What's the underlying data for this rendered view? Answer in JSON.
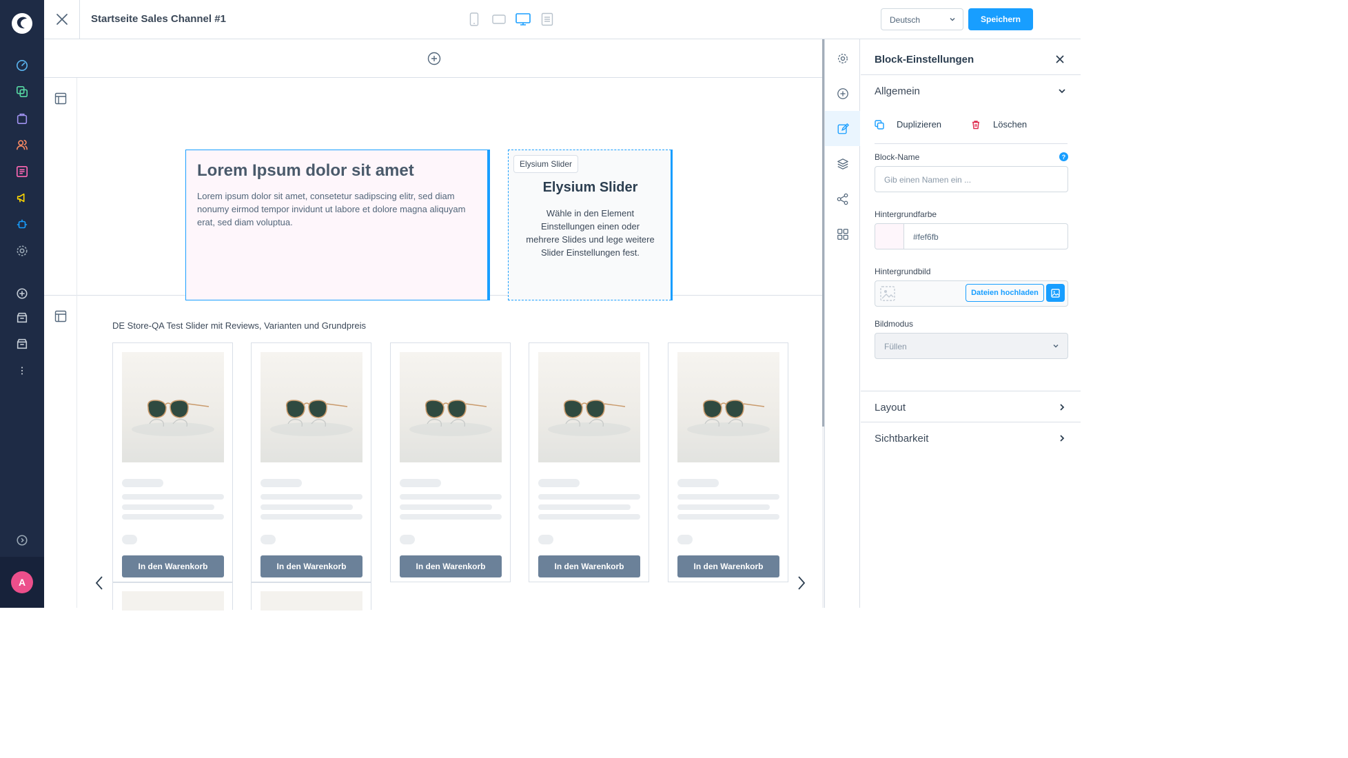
{
  "nav": {
    "avatar_initial": "A",
    "items": [
      {
        "icon": "dashboard-icon",
        "color": "#5ab4f0"
      },
      {
        "icon": "catalogues-icon",
        "color": "#57d9a3"
      },
      {
        "icon": "orders-icon",
        "color": "#a092f0"
      },
      {
        "icon": "customers-icon",
        "color": "#f88962"
      },
      {
        "icon": "content-icon",
        "color": "#ff68b4"
      },
      {
        "icon": "marketing-icon",
        "color": "#ffd700"
      },
      {
        "icon": "extensions-icon",
        "color": "#189eff"
      },
      {
        "icon": "settings-icon",
        "color": "#9aa8b5"
      }
    ]
  },
  "header": {
    "title": "Startseite Sales Channel #1",
    "language": "Deutsch",
    "save_label": "Speichern"
  },
  "canvas": {
    "text_block": {
      "heading": "Lorem Ipsum dolor sit amet",
      "body": "Lorem ipsum dolor sit amet, consetetur sadipscing elitr, sed diam nonumy eirmod tempor invidunt ut labore et dolore magna aliquyam erat, sed diam voluptua.",
      "background": "#fef6fb"
    },
    "slider_block": {
      "label": "Elysium Slider",
      "heading": "Elysium Slider",
      "body": "Wähle in den Element Einstellungen einen oder mehrere Slides und lege weitere Slider Einstellungen fest."
    },
    "product_slider": {
      "title": "DE Store-QA Test Slider mit Reviews, Varianten und Grundpreis",
      "products": [
        {
          "button": "In den Warenkorb"
        },
        {
          "button": "In den Warenkorb"
        },
        {
          "button": "In den Warenkorb"
        },
        {
          "button": "In den Warenkorb"
        },
        {
          "button": "In den Warenkorb"
        }
      ]
    }
  },
  "panel": {
    "title": "Block-Einstellungen",
    "sections": {
      "general": "Allgemein",
      "layout": "Layout",
      "visibility": "Sichtbarkeit"
    },
    "duplicate_label": "Duplizieren",
    "delete_label": "Löschen",
    "block_name": {
      "label": "Block-Name",
      "placeholder": "Gib einen Namen ein ...",
      "value": ""
    },
    "background_color": {
      "label": "Hintergrundfarbe",
      "value": "#fef6fb"
    },
    "background_image": {
      "label": "Hintergrundbild",
      "upload_label": "Dateien hochladen"
    },
    "image_mode": {
      "label": "Bildmodus",
      "value": "Füllen"
    }
  },
  "colors": {
    "accent": "#189eff",
    "nav_bg": "#1e2b45",
    "button_disabled": "#6b8199",
    "delete": "#de294c"
  }
}
